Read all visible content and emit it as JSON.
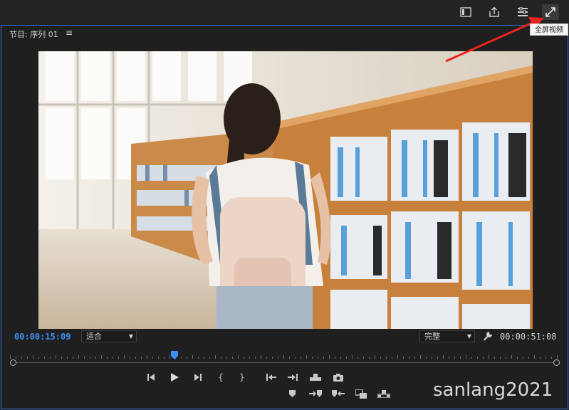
{
  "toolbar": {
    "tooltip": "全屏视频"
  },
  "panel": {
    "title": "节目: 序列 01",
    "menu_glyph": "≡"
  },
  "readout": {
    "current_timecode": "00:00:15:09",
    "zoom_select": "适合",
    "quality_select": "完整",
    "total_timecode": "00:00:51:08"
  },
  "timeline": {
    "playhead_fraction": 0.3
  },
  "transport": {
    "mark_in_glyph": "{",
    "mark_out_glyph": "}"
  },
  "watermark": "sanlang2021",
  "colors": {
    "accent": "#2d6fd6",
    "timecode": "#3b8ff3",
    "annotation_arrow": "#e8261f"
  }
}
